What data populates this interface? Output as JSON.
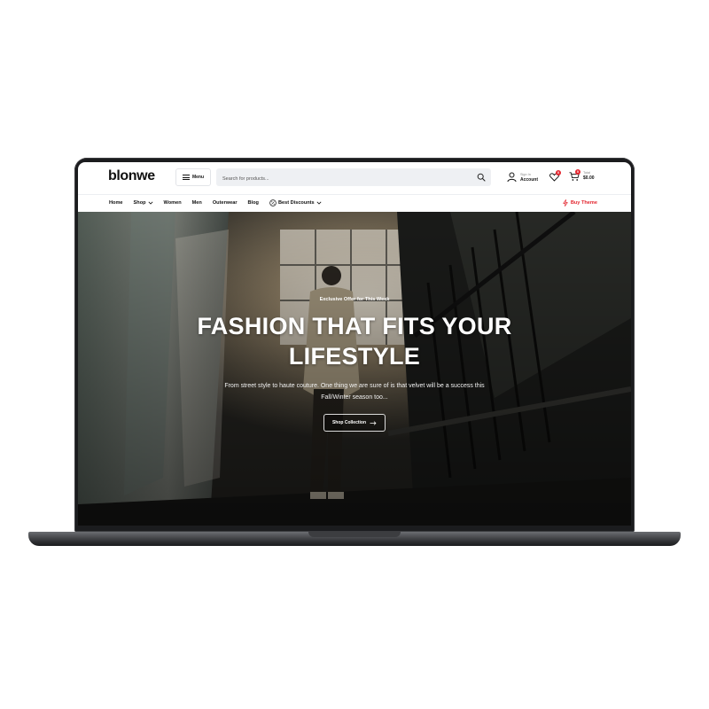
{
  "brand": {
    "logo": "blonwe"
  },
  "header": {
    "menu_label": "Menu",
    "search_placeholder": "Search for products...",
    "account": {
      "top": "Sign In",
      "bottom": "Account"
    },
    "wishlist_count": "0",
    "cart": {
      "count": "0",
      "top": "Total",
      "bottom": "$0.00"
    }
  },
  "nav": {
    "items": [
      {
        "label": "Home"
      },
      {
        "label": "Shop"
      },
      {
        "label": "Women"
      },
      {
        "label": "Men"
      },
      {
        "label": "Outerwear"
      },
      {
        "label": "Blog"
      },
      {
        "label": "Best Discounts"
      }
    ],
    "buy_theme": "Buy Theme"
  },
  "hero": {
    "eyebrow": "Exclusive Offer for This Week",
    "headline_line1": "FASHION THAT FITS YOUR",
    "headline_line2": "LIFESTYLE",
    "subtext": "From street style to haute couture. One thing we are sure of is that velvet will be a success this Fall/Winter season too...",
    "cta_label": "Shop Collection"
  },
  "colors": {
    "accent": "#e3262f",
    "text": "#111111",
    "search_bg": "#eef0f3"
  },
  "icons": [
    "hamburger-icon",
    "search-icon",
    "user-icon",
    "heart-icon",
    "cart-icon",
    "chevron-down-icon",
    "discount-icon",
    "lightning-icon",
    "arrow-right-icon"
  ]
}
